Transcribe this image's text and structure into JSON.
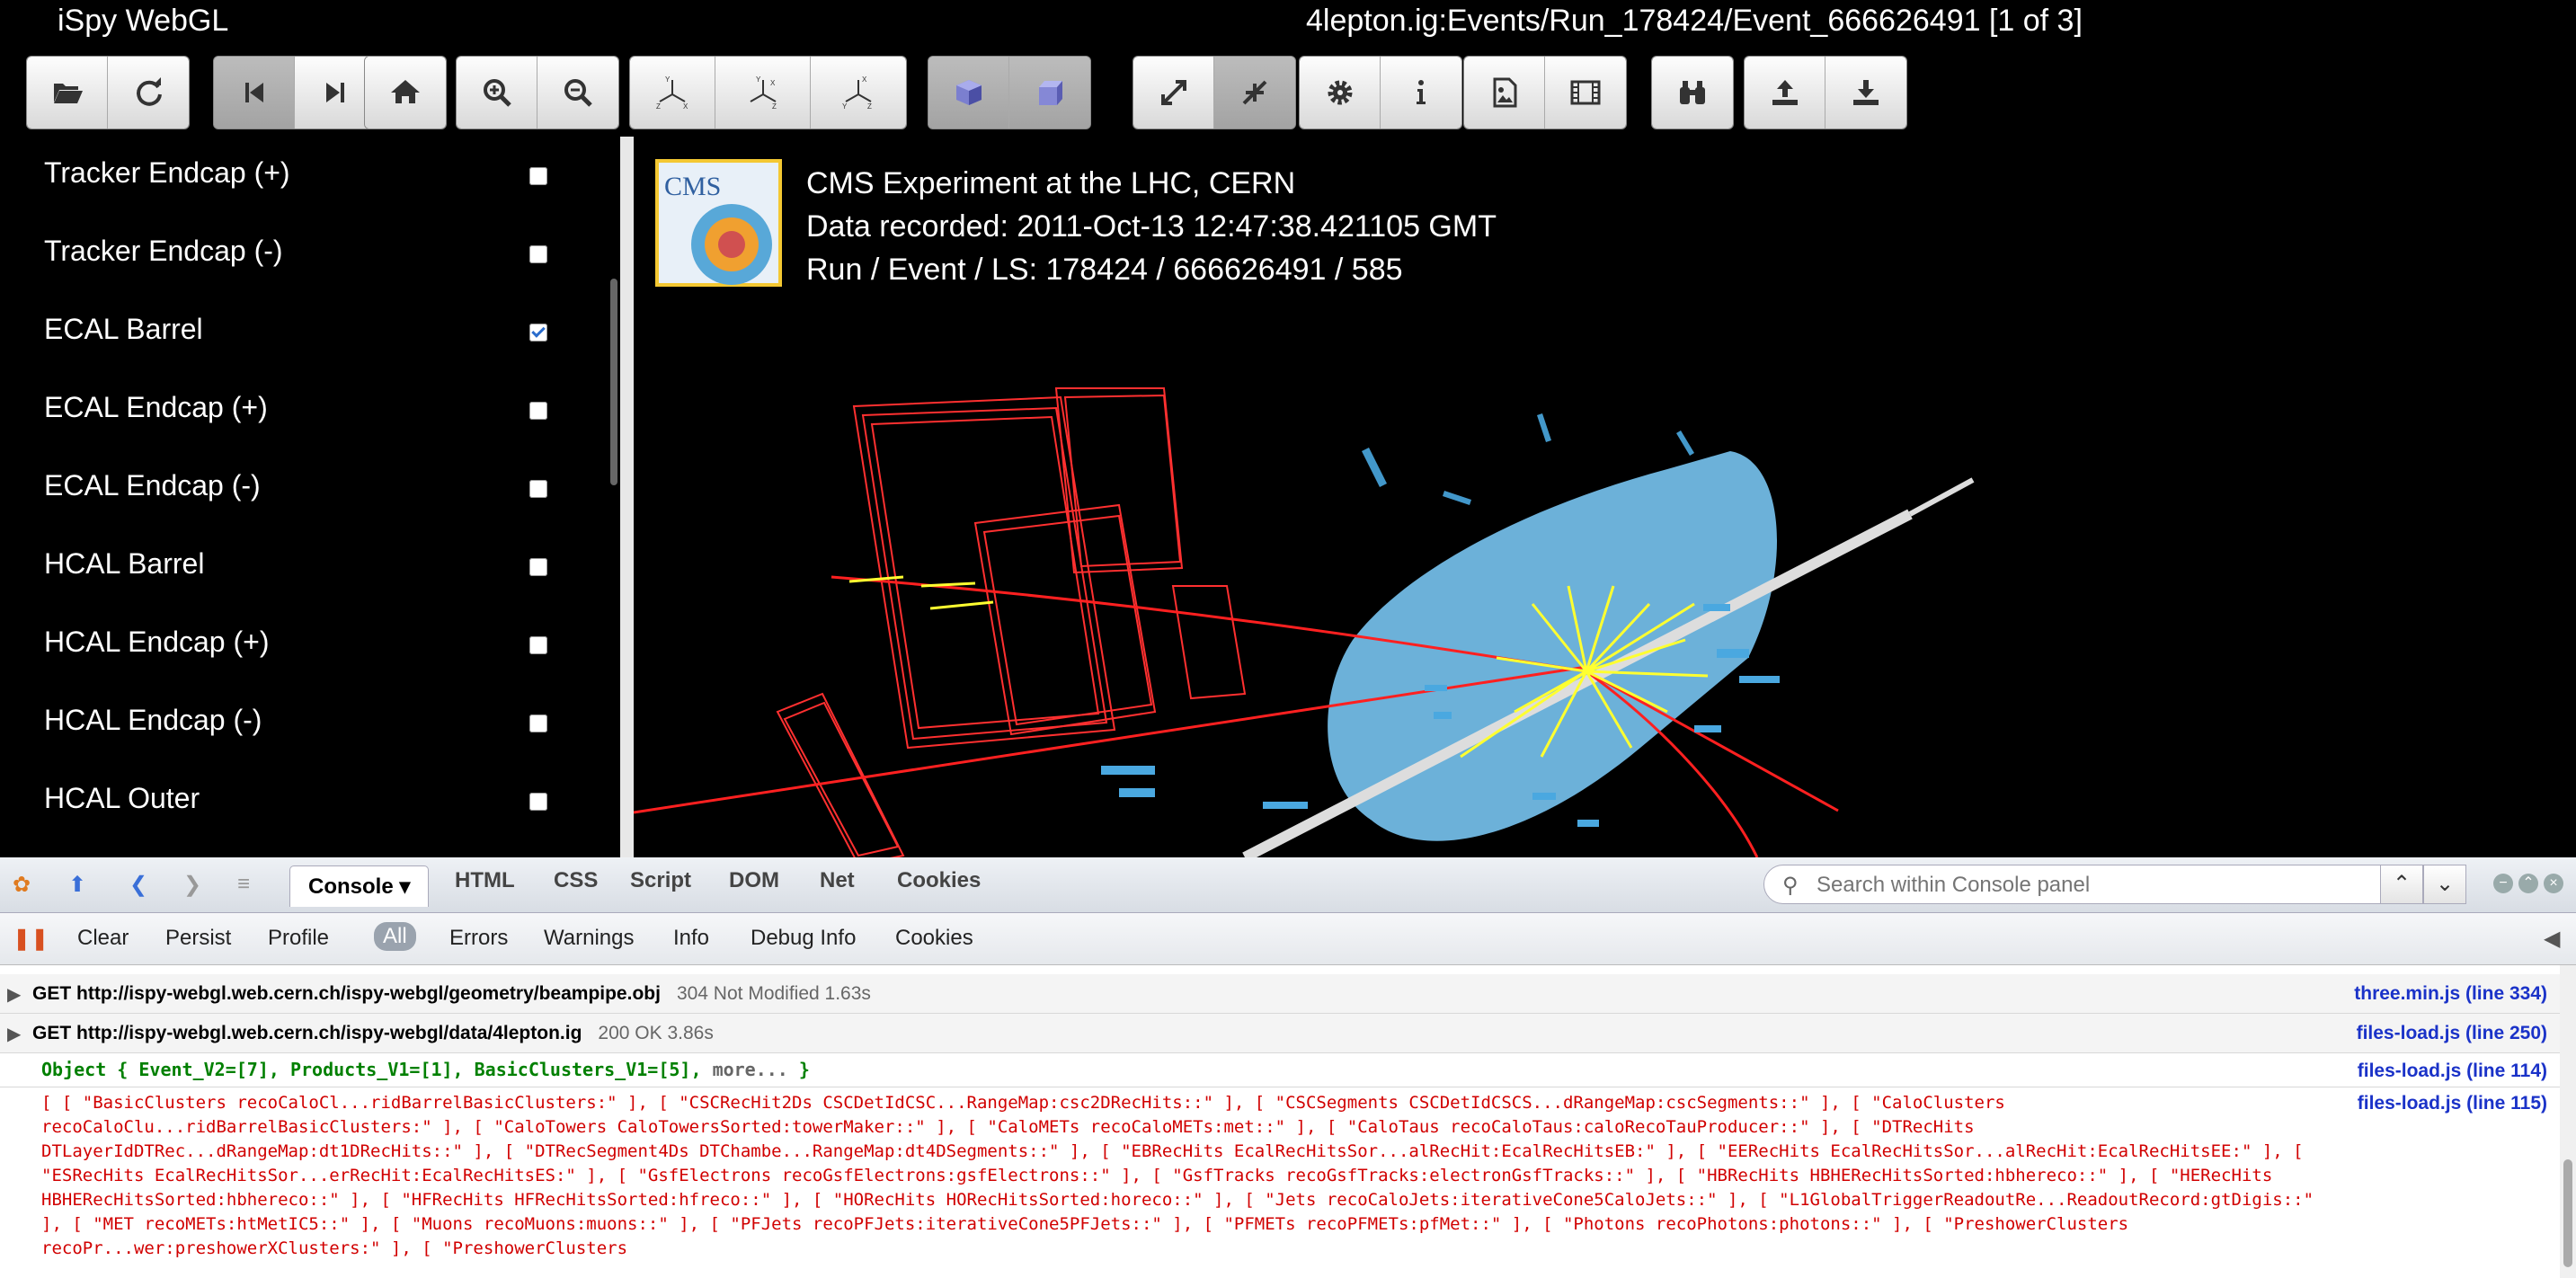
{
  "window": {
    "app_title": "iSpy WebGL",
    "event_title": "4lepton.ig:Events/Run_178424/Event_666626491 [1 of 3]"
  },
  "toolbar": {
    "buttons": [
      "open-file",
      "reload",
      "previous-event",
      "next-event",
      "home",
      "zoom-in",
      "zoom-out",
      "view-xyz",
      "view-xz",
      "view-yz",
      "perspective",
      "orthographic",
      "enter-fullscreen",
      "exit-fullscreen",
      "settings",
      "info",
      "export-image",
      "animate",
      "detector-display",
      "upload",
      "download"
    ]
  },
  "sidebar": {
    "items": [
      {
        "label": "Tracker Endcap (+)",
        "checked": false
      },
      {
        "label": "Tracker Endcap (-)",
        "checked": false
      },
      {
        "label": "ECAL Barrel",
        "checked": true
      },
      {
        "label": "ECAL Endcap (+)",
        "checked": false
      },
      {
        "label": "ECAL Endcap (-)",
        "checked": false
      },
      {
        "label": "HCAL Barrel",
        "checked": false
      },
      {
        "label": "HCAL Endcap (+)",
        "checked": false
      },
      {
        "label": "HCAL Endcap (-)",
        "checked": false
      },
      {
        "label": "HCAL Outer",
        "checked": false
      }
    ]
  },
  "viewport": {
    "logo_text": "CMS",
    "line1": "CMS Experiment at the LHC, CERN",
    "line2": "Data recorded: 2011-Oct-13 12:47:38.421105 GMT",
    "line3": "Run / Event / LS: 178424 / 666626491 / 585",
    "colors": {
      "tracks": "#ff2020",
      "electrons": "#ffff30",
      "calo": "#4aa8e0",
      "ecal_barrel": "#7fd0ff",
      "muon_chambers": "#ff3030"
    }
  },
  "firebug": {
    "tabs": [
      "Console",
      "HTML",
      "CSS",
      "Script",
      "DOM",
      "Net",
      "Cookies"
    ],
    "active_tab": "Console",
    "search_placeholder": "Search within Console panel",
    "filters": [
      "Clear",
      "Persist",
      "Profile",
      "All",
      "Errors",
      "Warnings",
      "Info",
      "Debug Info",
      "Cookies"
    ],
    "active_filter": "All",
    "console": [
      {
        "type": "net",
        "text": "GET http://ispy-webgl.web.cern.ch/ispy-webgl/geometry/beampipe.obj",
        "status": "304 Not Modified 1.63s",
        "source": "three.min.js (line 334)"
      },
      {
        "type": "net",
        "text": "GET http://ispy-webgl.web.cern.ch/ispy-webgl/data/4lepton.ig",
        "status": "200 OK 3.86s",
        "source": "files-load.js (line 250)"
      },
      {
        "type": "object",
        "text": "Object { Event_V2=[7], Products_V1=[1], BasicClusters_V1=[5],",
        "more": "more...",
        "close": "}",
        "source": "files-load.js (line 114)"
      },
      {
        "type": "array",
        "text": "[ [ \"BasicClusters recoCaloCl...ridBarrelBasicClusters:\" ], [ \"CSCRecHit2Ds CSCDetIdCSC...RangeMap:csc2DRecHits::\" ], [ \"CSCSegments CSCDetIdCSCS...dRangeMap:cscSegments::\" ], [ \"CaloClusters recoCaloClu...ridBarrelBasicClusters:\" ], [ \"CaloTowers CaloTowersSorted:towerMaker::\" ], [ \"CaloMETs recoCaloMETs:met::\" ], [ \"CaloTaus recoCaloTaus:caloRecoTauProducer::\" ], [ \"DTRecHits DTLayerIdDTRec...dRangeMap:dt1DRecHits::\" ], [ \"DTRecSegment4Ds DTChambe...RangeMap:dt4DSegments::\" ], [ \"EBRecHits EcalRecHitsSor...alRecHit:EcalRecHitsEB:\" ], [ \"EERecHits EcalRecHitsSor...alRecHit:EcalRecHitsEE:\" ], [ \"ESRecHits EcalRecHitsSor...erRecHit:EcalRecHitsES:\" ], [ \"GsfElectrons recoGsfElectrons:gsfElectrons::\" ], [ \"GsfTracks recoGsfTracks:electronGsfTracks::\" ], [ \"HBRecHits HBHERecHitsSorted:hbhereco::\" ], [ \"HERecHits HBHERecHitsSorted:hbhereco::\" ], [ \"HFRecHits HFRecHitsSorted:hfreco::\" ], [ \"HORecHits HORecHitsSorted:horeco::\" ], [ \"Jets recoCaloJets:iterativeCone5CaloJets::\" ], [ \"L1GlobalTriggerReadoutRe...ReadoutRecord:gtDigis::\" ], [ \"MET recoMETs:htMetIC5::\" ], [ \"Muons recoMuons:muons::\" ], [ \"PFJets recoPFJets:iterativeCone5PFJets::\" ], [ \"PFMETs recoPFMETs:pfMet::\" ], [ \"Photons recoPhotons:photons::\" ], [ \"PreshowerClusters recoPr...wer:preshowerXClusters:\" ], [ \"PreshowerClusters",
        "source": "files-load.js (line 115)"
      }
    ]
  }
}
